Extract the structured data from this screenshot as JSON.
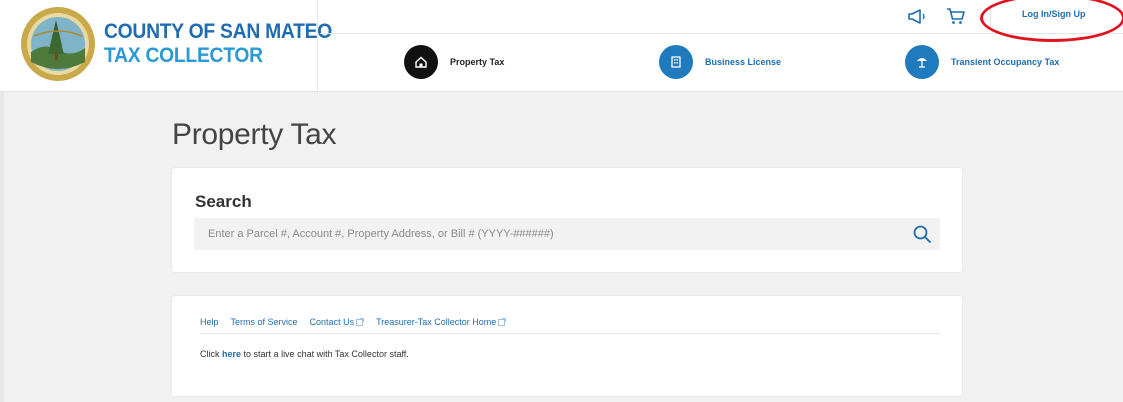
{
  "brand": {
    "line1": "COUNTY OF SAN MATEO",
    "line2": "TAX COLLECTOR",
    "color_primary": "#1f6db0",
    "color_secondary": "#2a9ad6"
  },
  "utility": {
    "icons": [
      "megaphone-icon",
      "cart-icon"
    ],
    "login_label": "Log In/Sign Up"
  },
  "nav": [
    {
      "label": "Property Tax",
      "icon": "home-icon",
      "active": true,
      "color": "#111111"
    },
    {
      "label": "Business License",
      "icon": "building-icon",
      "active": false,
      "color": "#1f7bbd"
    },
    {
      "label": "Transient Occupancy Tax",
      "icon": "umbrella-icon",
      "active": false,
      "color": "#1f7bbd"
    }
  ],
  "main": {
    "title": "Property Tax",
    "search": {
      "heading": "Search",
      "placeholder": "Enter a Parcel #, Account #, Property Address, or Bill # (YYYY-######)"
    }
  },
  "footer": {
    "links": [
      {
        "label": "Help",
        "external": false
      },
      {
        "label": "Terms of Service",
        "external": false
      },
      {
        "label": "Contact Us",
        "external": true
      },
      {
        "label": "Treasurer-Tax Collector Home",
        "external": true
      }
    ],
    "chat_prefix": "Click",
    "chat_link": "here",
    "chat_suffix": "to start a live chat with Tax Collector staff."
  }
}
